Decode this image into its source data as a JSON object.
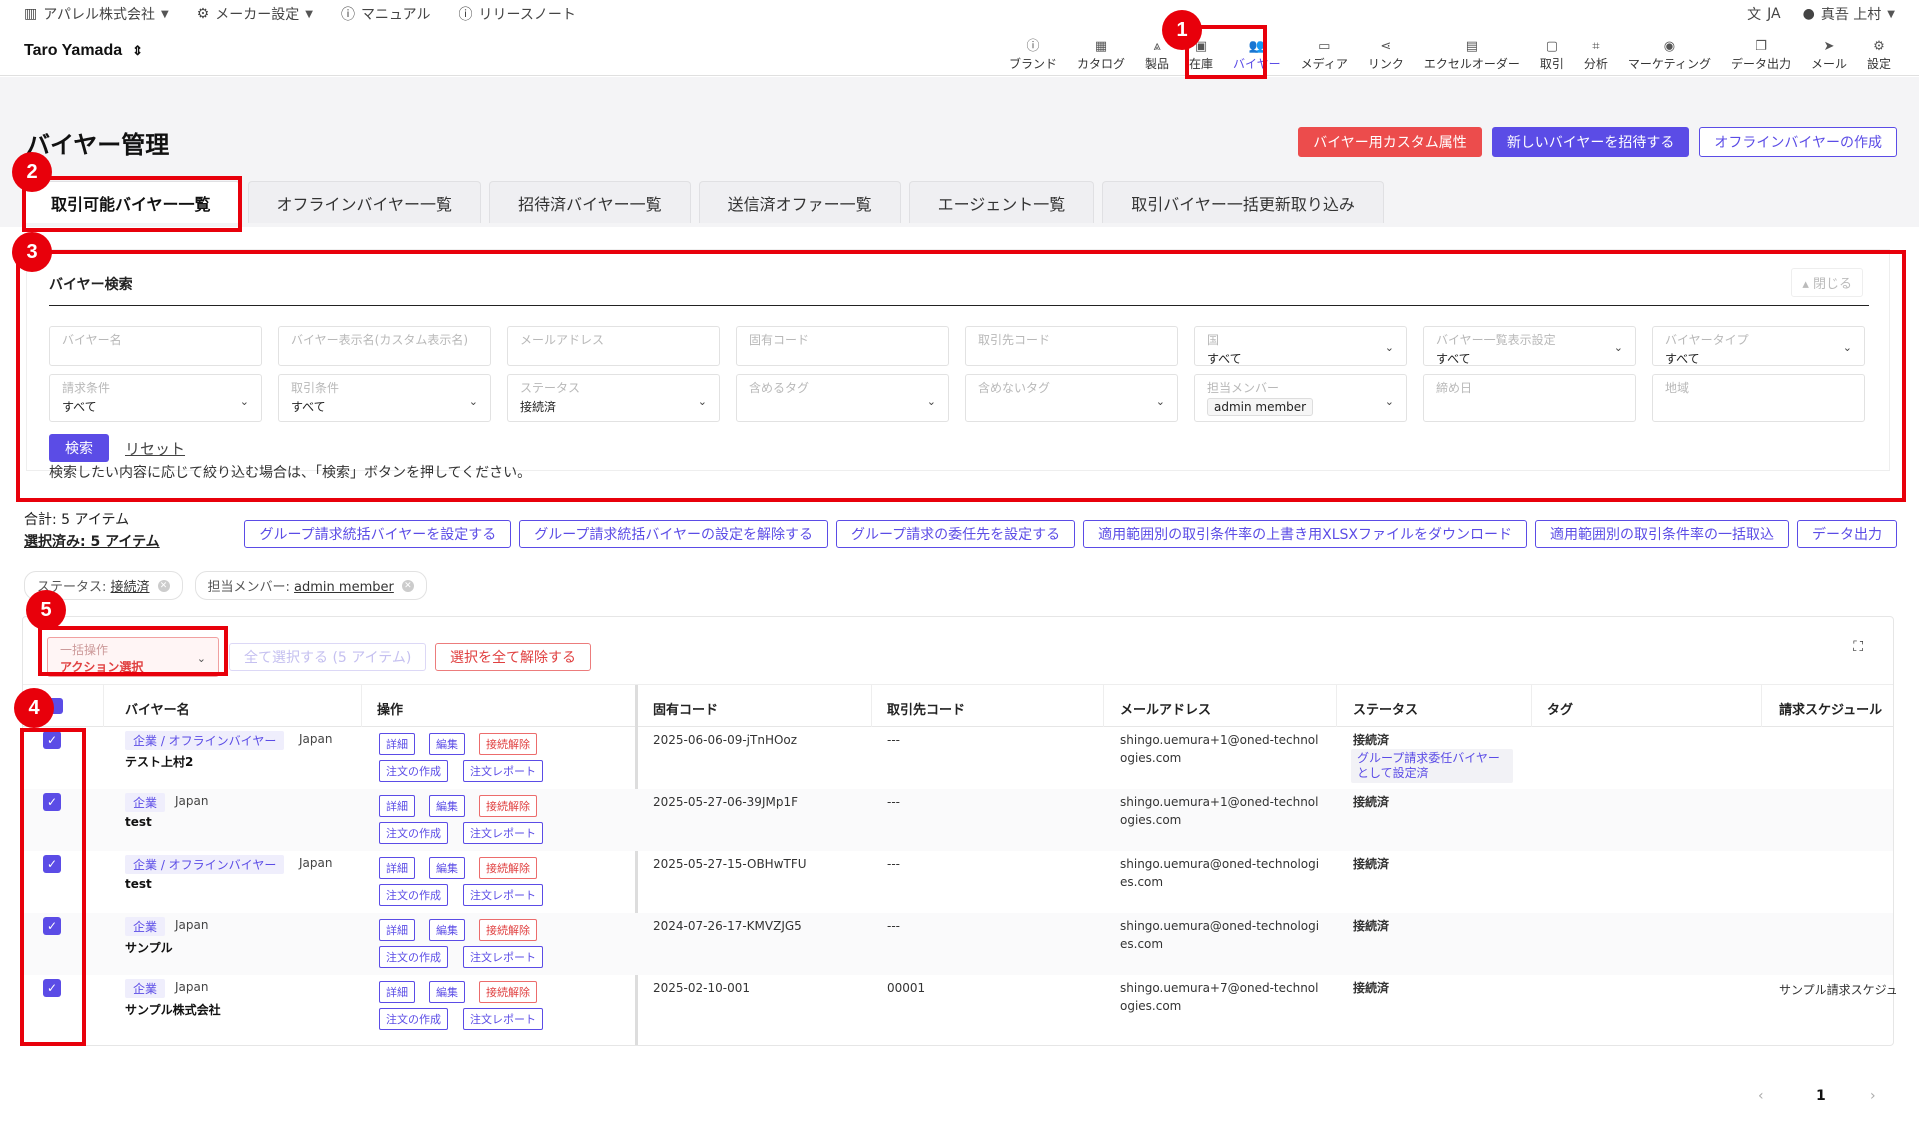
{
  "topbar": {
    "company": "アパレル株式会社",
    "maker_settings": "メーカー設定",
    "manual": "マニュアル",
    "release_notes": "リリースノート",
    "language": "JA",
    "user_name": "真吾 上村"
  },
  "header": {
    "account": "Taro Yamada",
    "nav": [
      {
        "label": "ブランド",
        "icon": "info-icon"
      },
      {
        "label": "カタログ",
        "icon": "grid-icon"
      },
      {
        "label": "製品",
        "icon": "hanger-icon"
      },
      {
        "label": "在庫",
        "icon": "box-icon"
      },
      {
        "label": "バイヤー",
        "icon": "users-icon"
      },
      {
        "label": "メディア",
        "icon": "cast-icon"
      },
      {
        "label": "リンク",
        "icon": "share-icon"
      },
      {
        "label": "エクセルオーダー",
        "icon": "excel-icon"
      },
      {
        "label": "取引",
        "icon": "receipt-icon"
      },
      {
        "label": "分析",
        "icon": "chart-icon"
      },
      {
        "label": "マーケティング",
        "icon": "broadcast-icon"
      },
      {
        "label": "データ出力",
        "icon": "copy-icon"
      },
      {
        "label": "メール",
        "icon": "send-icon"
      },
      {
        "label": "設定",
        "icon": "gear-icon"
      }
    ]
  },
  "page": {
    "title": "バイヤー管理",
    "actions": {
      "custom_attr": "バイヤー用カスタム属性",
      "invite": "新しいバイヤーを招待する",
      "create_offline": "オフラインバイヤーの作成"
    },
    "tabs": [
      "取引可能バイヤー一覧",
      "オフラインバイヤー一覧",
      "招待済バイヤー一覧",
      "送信済オファー一覧",
      "エージェント一覧",
      "取引バイヤー一括更新取り込み"
    ]
  },
  "search": {
    "title": "バイヤー検索",
    "close": "閉じる",
    "fields": {
      "buyer_name": "バイヤー名",
      "display_name": "バイヤー表示名(カスタム表示名)",
      "email": "メールアドレス",
      "unique_code": "固有コード",
      "partner_code": "取引先コード",
      "country": {
        "label": "国",
        "value": "すべて"
      },
      "list_display": {
        "label": "バイヤー一覧表示設定",
        "value": "すべて"
      },
      "buyer_type": {
        "label": "バイヤータイプ",
        "value": "すべて"
      },
      "billing": {
        "label": "請求条件",
        "value": "すべて"
      },
      "terms": {
        "label": "取引条件",
        "value": "すべて"
      },
      "status": {
        "label": "ステータス",
        "value": "接続済"
      },
      "include_tags": "含めるタグ",
      "exclude_tags": "含めないタグ",
      "member": {
        "label": "担当メンバー",
        "value": "admin member"
      },
      "closing_date": "締め日",
      "region": "地域"
    },
    "search_btn": "検索",
    "reset": "リセット",
    "hint": "検索したい内容に応じて絞り込む場合は、「検索」ボタンを押してください。"
  },
  "results": {
    "total": "合計: 5 アイテム",
    "selected": "選択済み: 5 アイテム",
    "bulk_buttons": [
      "グループ請求統括バイヤーを設定する",
      "グループ請求統括バイヤーの設定を解除する",
      "グループ請求の委任先を設定する",
      "適用範囲別の取引条件率の上書き用XLSXファイルをダウンロード",
      "適用範囲別の取引条件率の一括取込",
      "データ出力"
    ],
    "filters": [
      {
        "label": "ステータス: ",
        "value": "接続済"
      },
      {
        "label": "担当メンバー: ",
        "value": "admin member"
      }
    ]
  },
  "table": {
    "bulk_label": "一括操作",
    "bulk_value": "アクション選択",
    "select_all": "全て選択する (5 アイテム)",
    "deselect_all": "選択を全て解除する",
    "headers": {
      "name": "バイヤー名",
      "ops": "操作",
      "code": "固有コード",
      "partner": "取引先コード",
      "email": "メールアドレス",
      "status": "ステータス",
      "tag": "タグ",
      "schedule": "請求スケジュール"
    },
    "ops": {
      "detail": "詳細",
      "edit": "編集",
      "disconnect": "接続解除",
      "order": "注文の作成",
      "report": "注文レポート"
    },
    "rows": [
      {
        "type": "企業 / オフラインバイヤー",
        "country": "Japan",
        "name": "テスト上村2",
        "code": "2025-06-06-09-jTnHOoz",
        "partner": "---",
        "email": "shingo.uemura+1@oned-technologies.com",
        "status": "接続済",
        "note": "グループ請求委任バイヤーとして設定済",
        "schedule": ""
      },
      {
        "type": "企業",
        "country": "Japan",
        "name": "test",
        "code": "2025-05-27-06-39JMp1F",
        "partner": "---",
        "email": "shingo.uemura+1@oned-technologies.com",
        "status": "接続済",
        "note": "",
        "schedule": ""
      },
      {
        "type": "企業 / オフラインバイヤー",
        "country": "Japan",
        "name": "test",
        "code": "2025-05-27-15-OBHwTFU",
        "partner": "---",
        "email": "shingo.uemura@oned-technologies.com",
        "status": "接続済",
        "note": "",
        "schedule": ""
      },
      {
        "type": "企業",
        "country": "Japan",
        "name": "サンプル",
        "code": "2024-07-26-17-KMVZJG5",
        "partner": "---",
        "email": "shingo.uemura@oned-technologies.com",
        "status": "接続済",
        "note": "",
        "schedule": ""
      },
      {
        "type": "企業",
        "country": "Japan",
        "name": "サンプル株式会社",
        "code": "2025-02-10-001",
        "partner": "00001",
        "email": "shingo.uemura+7@oned-technologies.com",
        "status": "接続済",
        "note": "",
        "schedule": "サンプル請求スケジュ"
      }
    ]
  },
  "pagination": {
    "prev": "‹",
    "page": "1",
    "next": "›"
  },
  "annotations": {
    "markers": [
      "1",
      "2",
      "3",
      "4",
      "5"
    ],
    "color": "#e8000b"
  }
}
